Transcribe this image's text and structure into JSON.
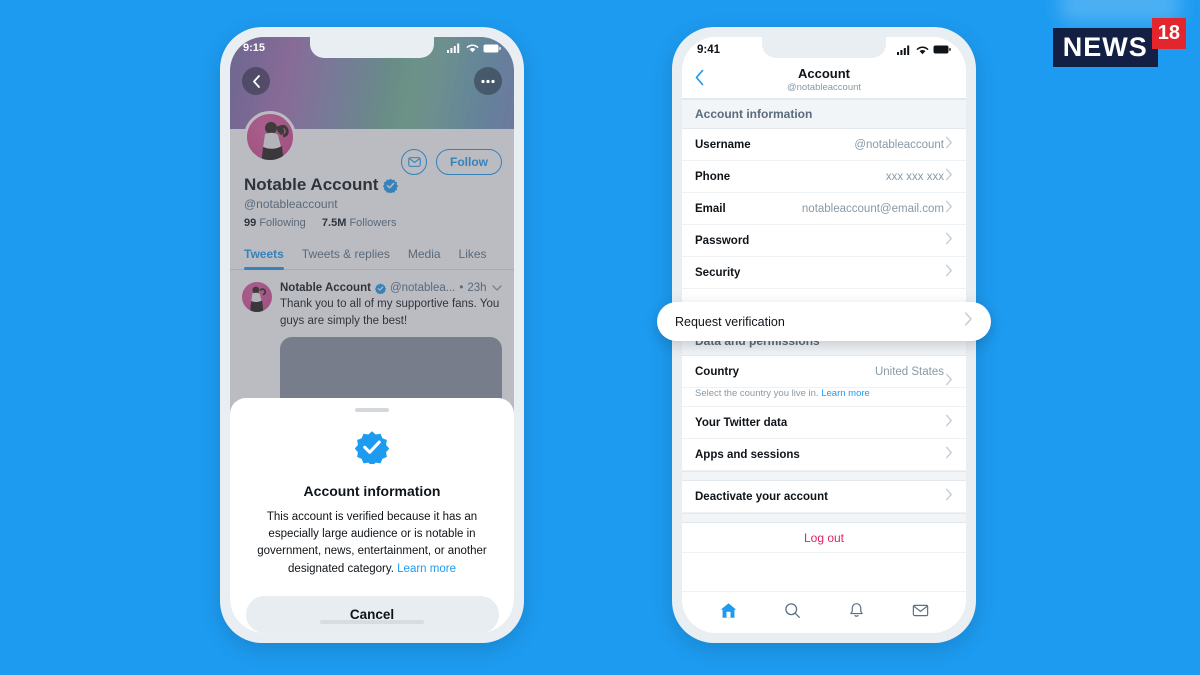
{
  "watermark": {
    "brand": "NEWS",
    "badge": "18"
  },
  "left_phone": {
    "status": {
      "time": "9:15"
    },
    "profile": {
      "name": "Notable Account",
      "handle": "@notableaccount",
      "following_count": "99",
      "following_label": "Following",
      "followers_count": "7.5M",
      "followers_label": "Followers",
      "follow_button": "Follow",
      "verified": true
    },
    "tabs": [
      {
        "label": "Tweets",
        "active": true
      },
      {
        "label": "Tweets & replies",
        "active": false
      },
      {
        "label": "Media",
        "active": false
      },
      {
        "label": "Likes",
        "active": false
      }
    ],
    "tweet": {
      "author": "Notable Account",
      "handle": "@notablea...",
      "separator": "•",
      "time": "23h",
      "text": "Thank you to all of my supportive fans. You guys are simply the best!"
    },
    "sheet": {
      "title": "Account information",
      "body": "This account is verified because it has an especially large audience or is notable in government, news, entertainment, or another designated category.",
      "learn_more": "Learn more",
      "cancel_label": "Cancel"
    }
  },
  "right_phone": {
    "status": {
      "time": "9:41"
    },
    "navbar": {
      "title": "Account",
      "subtitle": "@notableaccount"
    },
    "sections": [
      {
        "header": "Account information",
        "rows": [
          {
            "label": "Username",
            "value": "@notableaccount"
          },
          {
            "label": "Phone",
            "value": "xxx xxx xxx"
          },
          {
            "label": "Email",
            "value": "notableaccount@email.com"
          },
          {
            "label": "Password",
            "value": ""
          },
          {
            "label": "Security",
            "value": ""
          }
        ]
      },
      {
        "header": "Data and permissions",
        "rows": [
          {
            "label": "Country",
            "value": "United States",
            "sub": "Select the country you live in.",
            "sub_link": "Learn more"
          },
          {
            "label": "Your Twitter data",
            "value": ""
          },
          {
            "label": "Apps and sessions",
            "value": ""
          }
        ]
      },
      {
        "header": "",
        "rows": [
          {
            "label": "Deactivate your account",
            "value": ""
          }
        ]
      }
    ],
    "highlight_row": {
      "label": "Request verification"
    },
    "logout_label": "Log out",
    "tabbar": [
      {
        "icon": "home-icon",
        "active": true
      },
      {
        "icon": "search-icon",
        "active": false
      },
      {
        "icon": "bell-icon",
        "active": false
      },
      {
        "icon": "envelope-icon",
        "active": false
      }
    ]
  },
  "colors": {
    "background": "#1d9bf0",
    "twitter_blue": "#1d9bf0",
    "logout_red": "#e0245e",
    "news18_navy": "#132043",
    "news18_red": "#e3262e"
  }
}
